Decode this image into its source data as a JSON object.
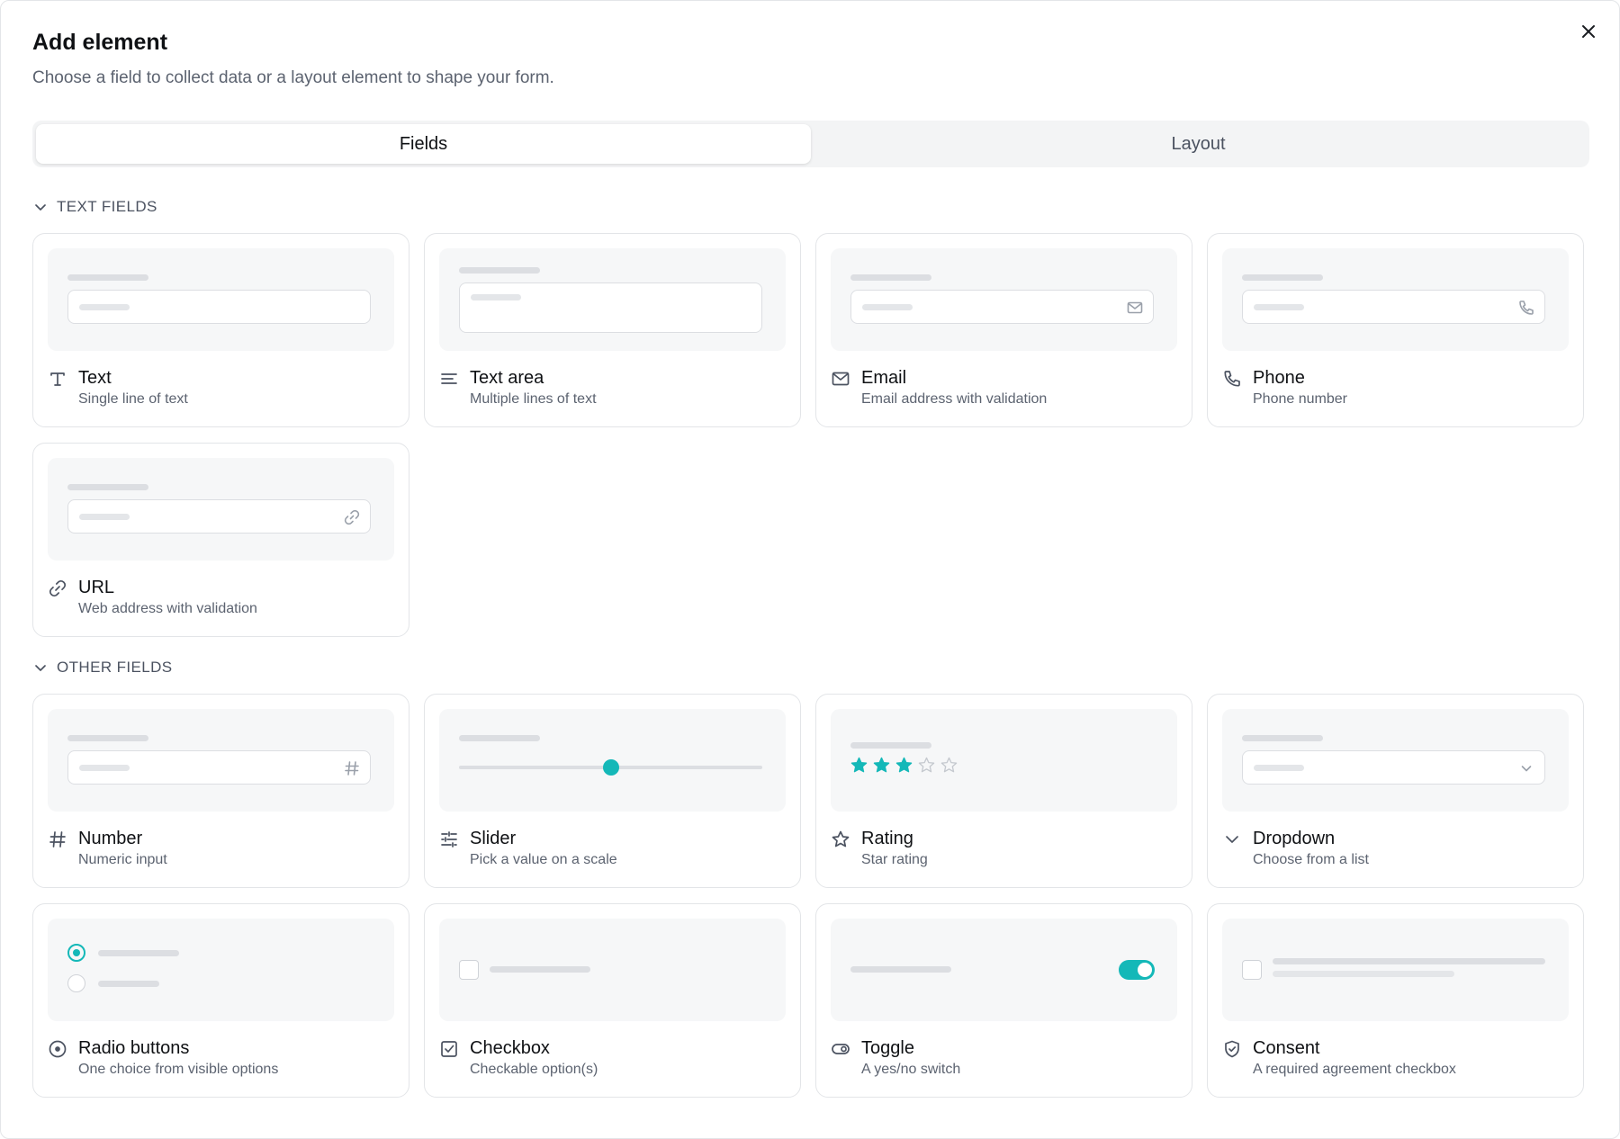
{
  "dialog": {
    "title": "Add element",
    "subtitle": "Choose a field to collect data or a layout element to shape your form.",
    "close_icon": "close-icon"
  },
  "tabs": [
    {
      "label": "Fields",
      "active": true
    },
    {
      "label": "Layout",
      "active": false
    }
  ],
  "sections": {
    "text_fields": {
      "label": "TEXT FIELDS"
    },
    "other_fields": {
      "label": "OTHER FIELDS"
    }
  },
  "cards": {
    "text": {
      "title": "Text",
      "desc": "Single line of text",
      "icon": "text-icon"
    },
    "textarea": {
      "title": "Text area",
      "desc": "Multiple lines of text",
      "icon": "align-left-icon"
    },
    "email": {
      "title": "Email",
      "desc": "Email address with validation",
      "icon": "mail-icon"
    },
    "phone": {
      "title": "Phone",
      "desc": "Phone number",
      "icon": "phone-icon"
    },
    "url": {
      "title": "URL",
      "desc": "Web address with validation",
      "icon": "link-icon"
    },
    "number": {
      "title": "Number",
      "desc": "Numeric input",
      "icon": "hash-icon"
    },
    "slider": {
      "title": "Slider",
      "desc": "Pick a value on a scale",
      "icon": "sliders-icon",
      "preview_value": 0.5
    },
    "rating": {
      "title": "Rating",
      "desc": "Star rating",
      "icon": "star-icon",
      "preview_rating": 3,
      "preview_max": 5
    },
    "dropdown": {
      "title": "Dropdown",
      "desc": "Choose from a list",
      "icon": "chevron-down-icon"
    },
    "radio": {
      "title": "Radio buttons",
      "desc": "One choice from visible options",
      "icon": "radio-icon"
    },
    "checkbox": {
      "title": "Checkbox",
      "desc": "Checkable option(s)",
      "icon": "checkbox-icon"
    },
    "toggle": {
      "title": "Toggle",
      "desc": "A yes/no switch",
      "icon": "toggle-icon",
      "preview_on": true
    },
    "consent": {
      "title": "Consent",
      "desc": "A required agreement checkbox",
      "icon": "shield-check-icon"
    }
  },
  "colors": {
    "accent": "#14b8b8",
    "border": "#e3e5e8",
    "preview_bg": "#f6f7f8",
    "muted_text": "#5c6370"
  }
}
